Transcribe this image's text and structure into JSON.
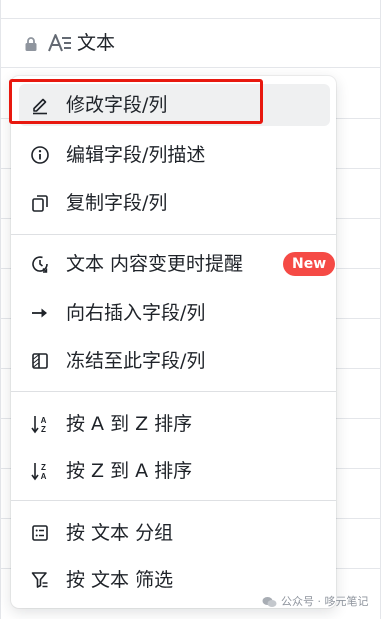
{
  "column": {
    "icons": [
      "lock-icon",
      "text-type-icon"
    ],
    "name": "文本"
  },
  "menu": {
    "groups": [
      [
        {
          "icon": "pencil-icon",
          "label": "修改字段/列",
          "highlighted": true
        },
        {
          "icon": "info-icon",
          "label": "编辑字段/列描述"
        },
        {
          "icon": "copy-icon",
          "label": "复制字段/列"
        }
      ],
      [
        {
          "icon": "clock-refresh-icon",
          "label": "文本 内容变更时提醒",
          "badge": "New"
        },
        {
          "icon": "arrow-right-icon",
          "label": "向右插入字段/列"
        },
        {
          "icon": "freeze-column-icon",
          "label": "冻结至此字段/列"
        }
      ],
      [
        {
          "icon": "sort-a-z-icon",
          "label": "按 A 到 Z 排序"
        },
        {
          "icon": "sort-z-a-icon",
          "label": "按 Z 到 A 排序"
        }
      ],
      [
        {
          "icon": "group-list-icon",
          "label": "按 文本 分组"
        },
        {
          "icon": "filter-icon",
          "label": "按 文本 筛选"
        }
      ]
    ]
  },
  "colors": {
    "highlight_border": "#e8180f",
    "badge_bg": "#f54a45",
    "active_item_bg": "#eff0f1"
  },
  "watermark": {
    "icon": "wechat-icon",
    "text": "公众号 · 哆元笔记"
  }
}
